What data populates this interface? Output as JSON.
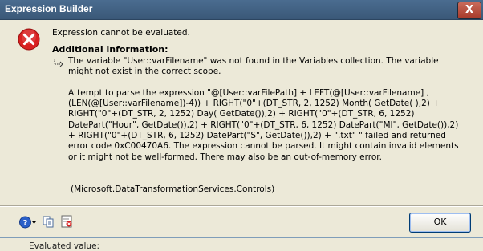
{
  "window": {
    "title": "Expression Builder",
    "close_label": "X"
  },
  "message": "Expression cannot be evaluated.",
  "additional_info_label": "Additional information:",
  "details": {
    "paragraph1": "The variable \"User::varFilename\" was not found in the Variables collection. The variable might not exist in the correct scope.",
    "paragraph2": "Attempt to parse the expression \"@[User::varFilePath] + LEFT(@[User::varFilename] ,(LEN(@[User::varFilename])-4)) + RIGHT(\"0\"+(DT_STR, 2, 1252) Month( GetDate( ),2) + RIGHT(\"0\"+(DT_STR, 2, 1252) Day( GetDate()),2) + RIGHT(\"0\"+(DT_STR, 6, 1252) DatePart(\"Hour\", GetDate()),2) + RIGHT(\"0\"+(DT_STR, 6, 1252) DatePart(\"MI\", GetDate()),2) + RIGHT(\"0\"+(DT_STR, 6, 1252) DatePart(\"S\", GetDate()),2) + \".txt\" \" failed and returned error code 0xC00470A6. The expression cannot be parsed. It might contain invalid elements or it might not be well-formed. There may also be an out-of-memory error."
  },
  "source": "(Microsoft.DataTransformationServices.Controls)",
  "buttons": {
    "ok": "OK"
  },
  "icons": {
    "error": "error-icon",
    "arrow": "arrow-return-icon",
    "help": "help-icon",
    "copy": "copy-icon",
    "details": "details-icon"
  },
  "background_fragment": "Evaluated value:",
  "colors": {
    "titlebar": "#3a5878",
    "dialog_bg": "#ece9d8",
    "error_red": "#d82020"
  }
}
